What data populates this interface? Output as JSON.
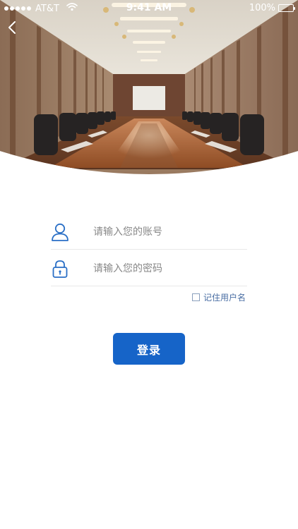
{
  "status_bar": {
    "carrier": "AT&T",
    "time": "9:41 AM",
    "battery": "100%"
  },
  "icons": {
    "back": "chevron-left-icon",
    "user": "user-icon",
    "lock": "lock-icon",
    "wifi": "wifi-icon",
    "battery": "battery-icon"
  },
  "login_form": {
    "account_placeholder": "请输入您的账号",
    "password_placeholder": "请输入您的密码",
    "remember_label": "记住用户名",
    "remember_checked": false,
    "submit_label": "登录"
  },
  "colors": {
    "primary": "#1664c8",
    "icon": "#2a6fc6",
    "placeholder": "#888888",
    "divider": "#e8e8e8"
  }
}
